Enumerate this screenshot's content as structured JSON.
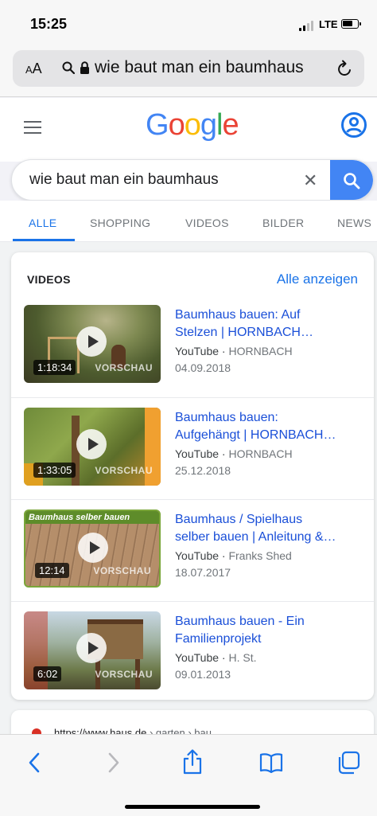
{
  "status": {
    "time": "15:25",
    "network": "LTE"
  },
  "address": {
    "aa": "AA",
    "url": "wie baut man ein baumhaus"
  },
  "google": {
    "logo": [
      "G",
      "o",
      "o",
      "g",
      "l",
      "e"
    ],
    "logo_colors": [
      "#4285f4",
      "#ea4335",
      "#fbbc05",
      "#4285f4",
      "#34a853",
      "#ea4335"
    ]
  },
  "search": {
    "query": "wie baut man ein baumhaus",
    "clear": "✕"
  },
  "tabs": [
    {
      "label": "ALLE",
      "active": true
    },
    {
      "label": "SHOPPING"
    },
    {
      "label": "VIDEOS"
    },
    {
      "label": "BILDER"
    },
    {
      "label": "NEWS"
    }
  ],
  "videos": {
    "heading": "VIDEOS",
    "see_all": "Alle anzeigen",
    "items": [
      {
        "title_1": "Baumhaus bauen: Auf",
        "title_2": "Stelzen | HORNBACH…",
        "source": "YouTube",
        "channel": "HORNBACH",
        "date": "04.09.2018",
        "duration": "1:18:34",
        "preview": "VORSCHAU"
      },
      {
        "title_1": "Baumhaus bauen:",
        "title_2": "Aufgehängt | HORNBACH…",
        "source": "YouTube",
        "channel": "HORNBACH",
        "date": "25.12.2018",
        "duration": "1:33:05",
        "preview": "VORSCHAU"
      },
      {
        "title_1": "Baumhaus / Spielhaus",
        "title_2": "selber bauen | Anleitung &…",
        "source": "YouTube",
        "channel": "Franks Shed",
        "date": "18.07.2017",
        "duration": "12:14",
        "preview": "VORSCHAU",
        "overlay": "Baumhaus selber bauen"
      },
      {
        "title_1": "Baumhaus bauen - Ein",
        "title_2": "Familienprojekt",
        "source": "YouTube",
        "channel": "H. St.",
        "date": "09.01.2013",
        "duration": "6:02",
        "preview": "VORSCHAU"
      }
    ]
  },
  "next_result": {
    "url": "https://www.haus.de",
    "path": " › garten › bau..."
  },
  "colors": {
    "accent": "#1a73e8",
    "link": "#1a4fd8",
    "search_button": "#4285f4"
  }
}
